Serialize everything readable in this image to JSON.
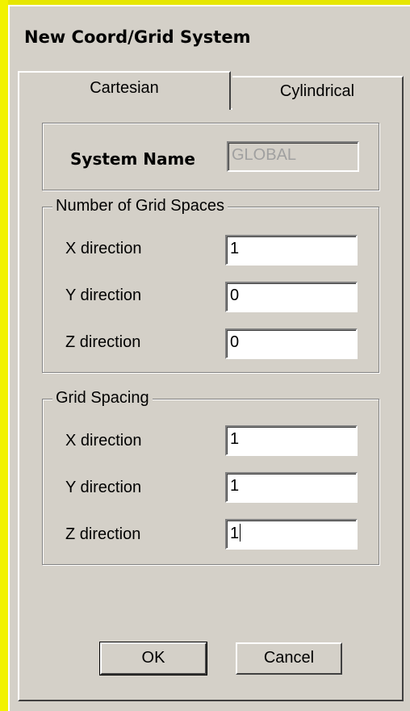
{
  "window": {
    "title": "New Coord/Grid System"
  },
  "tabs": [
    {
      "label": "Cartesian",
      "active": true
    },
    {
      "label": "Cylindrical",
      "active": false
    }
  ],
  "system_name": {
    "label": "System Name",
    "value": "GLOBAL"
  },
  "grid_spaces": {
    "title": "Number of Grid Spaces",
    "rows": [
      {
        "label": "X direction",
        "value": "1"
      },
      {
        "label": "Y direction",
        "value": "0"
      },
      {
        "label": "Z direction",
        "value": "0"
      }
    ]
  },
  "grid_spacing": {
    "title": "Grid Spacing",
    "rows": [
      {
        "label": "X direction",
        "value": "1"
      },
      {
        "label": "Y direction",
        "value": "1"
      },
      {
        "label": "Z direction",
        "value": "1"
      }
    ]
  },
  "buttons": {
    "ok": "OK",
    "cancel": "Cancel"
  },
  "colors": {
    "background": "#e6e600",
    "dialog": "#d4d0c8"
  }
}
